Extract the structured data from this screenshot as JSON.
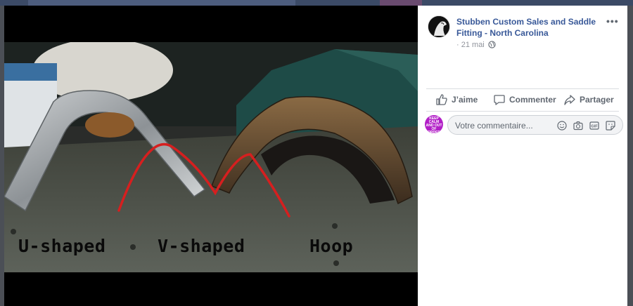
{
  "photo": {
    "labels": {
      "u": "U-shaped",
      "v": "V-shaped",
      "hoop": "Hoop"
    }
  },
  "post": {
    "page_name": "Stubben Custom Sales and Saddle Fitting - North Carolina",
    "date": "21 mai",
    "date_separator": "·"
  },
  "actions": {
    "like": "J’aime",
    "comment": "Commenter",
    "share": "Partager"
  },
  "comment": {
    "placeholder": "Votre commentaire...",
    "avatar_text": "KEEP CALM AND OUT OF ORDER"
  },
  "colors": {
    "link_blue": "#385898",
    "muted": "#606770",
    "overlay": "#4b4f56",
    "wire_red": "#d61f1f"
  }
}
